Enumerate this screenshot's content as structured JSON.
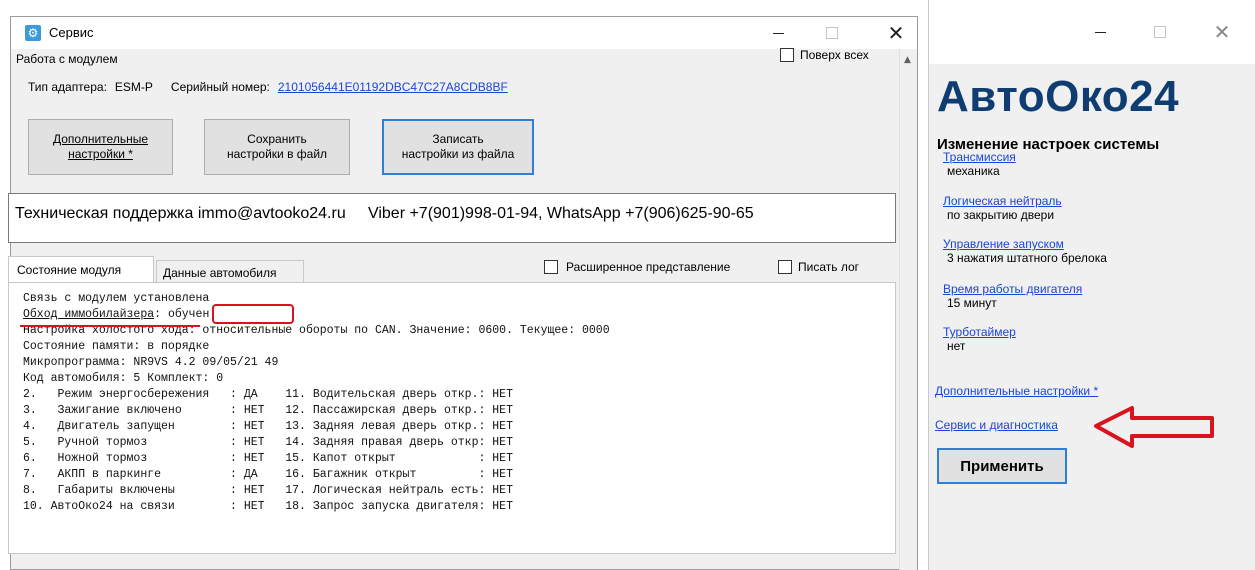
{
  "service_window": {
    "title": "Сервис",
    "module_group": {
      "label": "Работа с модулем",
      "always_on_top": "Поверх всех",
      "adapter_label": "Тип адаптера:",
      "adapter_value": "ESM-P",
      "serial_label": "Серийный номер:",
      "serial_value": "2101056441E01192DBC47C27A8CDB8BF",
      "buttons": {
        "extra_settings": "Дополнительные\nнастройки *",
        "save_settings": "Сохранить\nнастройки в файл",
        "load_settings": "Записать\nнастройки из файла"
      }
    },
    "support_text": "Техническая поддержка immo@avtooko24.ru     Viber +7(901)998-01-94, WhatsApp +7(906)625-90-65",
    "tabs": [
      "Состояние модуля",
      "Данные автомобиля"
    ],
    "extended_view": "Расширенное представление",
    "write_log": "Писать лог",
    "log": {
      "line1": "Связь с модулем установлена",
      "immo_label": "Обход иммобилайзера",
      "immo_value": "обучен",
      "line3": "Настройка холостого хода: относительные обороты по CAN. Значение: 0600. Текущее: 0000",
      "line4": "Состояние памяти: в порядке",
      "line5": "Микропрограмма: NR9VS 4.2 09/05/21 49",
      "line6": "Код автомобиля: 5 Комплект: 0",
      "rows": [
        "2.   Режим энергосбережения   : ДА    11. Водительская дверь откр.: НЕТ",
        "3.   Зажигание включено       : НЕТ   12. Пассажирская дверь откр.: НЕТ",
        "4.   Двигатель запущен        : НЕТ   13. Задняя левая дверь откр.: НЕТ",
        "5.   Ручной тормоз            : НЕТ   14. Задняя правая дверь откр: НЕТ",
        "6.   Ножной тормоз            : НЕТ   15. Капот открыт            : НЕТ",
        "7.   АКПП в паркинге          : ДА    16. Багажник открыт         : НЕТ",
        "8.   Габариты включены        : НЕТ   17. Логическая нейтраль есть: НЕТ",
        "10. АвтоОко24 на связи        : НЕТ   18. Запрос запуска двигателя: НЕТ"
      ]
    }
  },
  "avtooko_window": {
    "logo": "АвтоОко24",
    "heading": "Изменение настроек системы",
    "settings": [
      {
        "link": "Трансмиссия",
        "value": "механика"
      },
      {
        "link": "Логическая нейтраль",
        "value": "по закрытию двери"
      },
      {
        "link": "Управление запуском",
        "value": "3 нажатия штатного брелока"
      },
      {
        "link": "Время работы двигателя",
        "value": "15 минут"
      },
      {
        "link": "Турботаймер",
        "value": "нет"
      }
    ],
    "extra_settings_link": "Дополнительные настройки *",
    "service_link": "Сервис и диагностика",
    "apply_button": "Применить"
  },
  "colors": {
    "highlight": "#d9141e",
    "link": "#1a46d8",
    "logo": "#0f3d72",
    "focus_border": "#2f7fd5"
  },
  "icons": [
    "app-gear-icon",
    "minimize-icon",
    "maximize-icon",
    "close-icon",
    "red-arrow-icon"
  ]
}
